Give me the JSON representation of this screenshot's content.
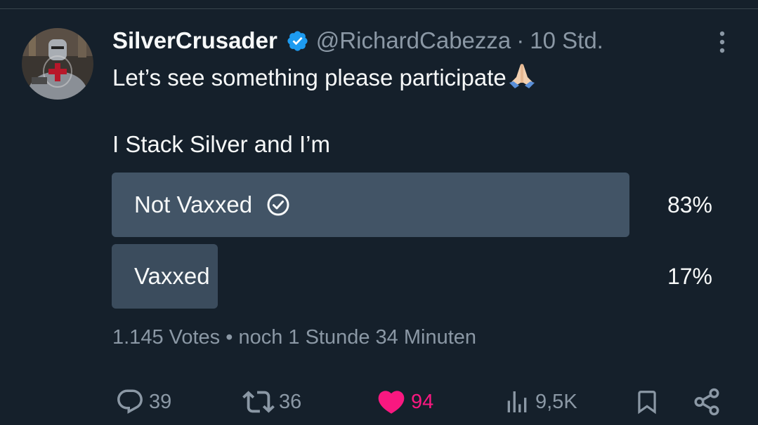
{
  "tweet": {
    "display_name": "SilverCrusader",
    "handle": "@RichardCabezza",
    "separator": "·",
    "time": "10 Std.",
    "verified": true,
    "text_line1": "Let’s see something please participate",
    "text_emoji": "folded-hands-emoji",
    "text_line2": "I Stack Silver and I’m"
  },
  "poll": {
    "options": [
      {
        "label": "Not Vaxxed",
        "percent_text": "83%",
        "percent": 83,
        "selected": true
      },
      {
        "label": "Vaxxed",
        "percent_text": "17%",
        "percent": 17,
        "selected": false
      }
    ],
    "meta": "1.145 Votes • noch 1 Stunde 34 Minuten"
  },
  "actions": {
    "reply": {
      "icon": "reply-icon",
      "count": "39"
    },
    "retweet": {
      "icon": "retweet-icon",
      "count": "36"
    },
    "like": {
      "icon": "heart-icon",
      "count": "94",
      "active": true
    },
    "views": {
      "icon": "views-icon",
      "count": "9,5K"
    },
    "bookmark": {
      "icon": "bookmark-icon"
    },
    "share": {
      "icon": "share-icon"
    }
  },
  "colors": {
    "background": "#15202b",
    "text_primary": "#f7f9f9",
    "text_secondary": "#8b98a5",
    "verified_blue": "#1d9bf0",
    "like_pink": "#f91880",
    "poll_fill_winner": "#425466",
    "poll_fill_other": "#3b4c5d"
  }
}
